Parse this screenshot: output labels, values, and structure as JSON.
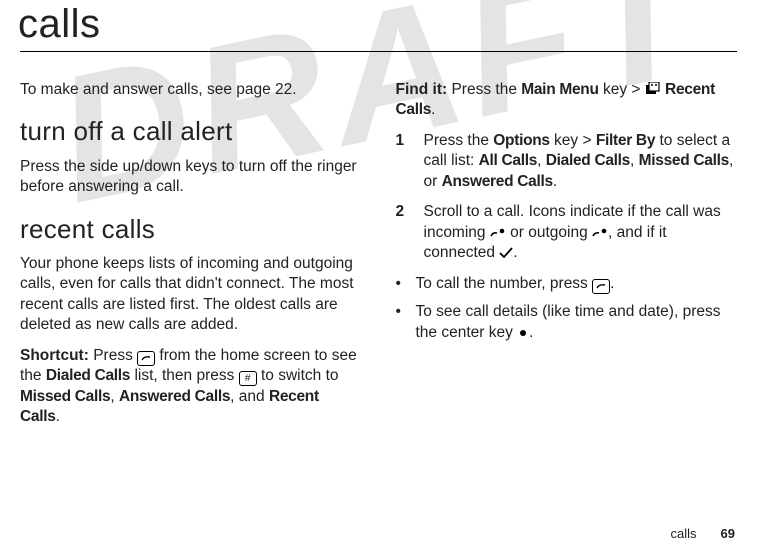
{
  "watermark": "DRAFT",
  "title": "calls",
  "left": {
    "intro": "To make and answer calls, see page 22.",
    "section1_heading": "turn off a call alert",
    "section1_body": "Press the side up/down keys to turn off the ringer before answering a call.",
    "section2_heading": "recent calls",
    "section2_body": "Your phone keeps lists of incoming and outgoing calls, even for calls that didn't connect. The most recent calls are listed first. The oldest calls are deleted as new calls are added.",
    "shortcut_label": "Shortcut:",
    "shortcut_1": " Press ",
    "shortcut_2": " from the home screen to see the ",
    "shortcut_bold1": "Dialed Calls",
    "shortcut_3": " list, then press ",
    "shortcut_key2": "#",
    "shortcut_4": " to switch to ",
    "shortcut_bold2": "Missed Calls",
    "shortcut_5": ", ",
    "shortcut_bold3": "Answered Calls",
    "shortcut_6": ", and ",
    "shortcut_bold4": "Recent Calls",
    "shortcut_7": "."
  },
  "right": {
    "findit_label": "Find it:",
    "findit_1": " Press the ",
    "findit_bold1": "Main Menu",
    "findit_2": " key > ",
    "findit_bold2": "Recent Calls",
    "findit_3": ".",
    "step1_num": "1",
    "step1_a": "Press the ",
    "step1_bold1": "Options",
    "step1_b": " key > ",
    "step1_bold2": "Filter By",
    "step1_c": " to select a call list: ",
    "step1_bold3": "All Calls",
    "step1_d": ", ",
    "step1_bold4": "Dialed Calls",
    "step1_e": ", ",
    "step1_bold5": "Missed Calls",
    "step1_f": ", or ",
    "step1_bold6": "Answered Calls",
    "step1_g": ".",
    "step2_num": "2",
    "step2_a": "Scroll to a call. Icons indicate if the call was incoming ",
    "step2_b": " or outgoing ",
    "step2_c": ", and if it connected ",
    "step2_d": ".",
    "bullet1_a": "To call the number, press ",
    "bullet1_b": ".",
    "bullet2_a": "To see call details (like time and date), press the center key ",
    "bullet2_b": "."
  },
  "footer": {
    "label": "calls",
    "page": "69"
  }
}
